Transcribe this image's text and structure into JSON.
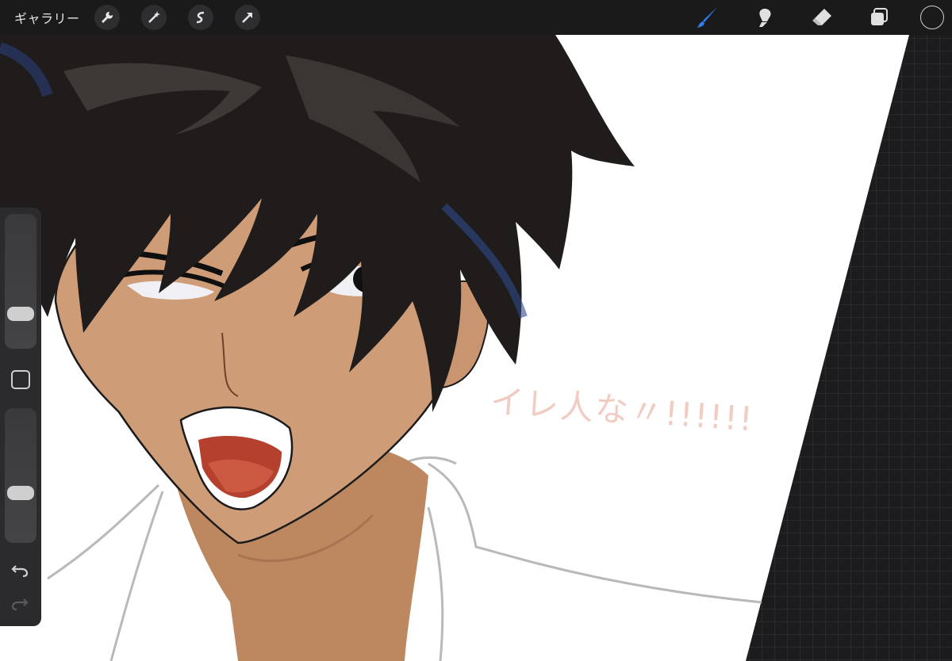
{
  "toolbar": {
    "gallery_label": "ギャラリー",
    "left_tools": [
      "wrench-icon",
      "magic-wand-icon",
      "selection-icon",
      "transform-arrow-icon"
    ],
    "right_tools": [
      "brush-icon",
      "smudge-icon",
      "eraser-icon",
      "layers-icon"
    ],
    "active_tool": "brush",
    "active_color": "#1a1a1a",
    "accent_color": "#2f80ed"
  },
  "sidebar": {
    "brush_size_level": 0.22,
    "opacity_level": 0.35,
    "modify_button_icon": "square-icon",
    "undo_icon": "undo-icon",
    "redo_icon": "redo-icon"
  },
  "artwork": {
    "sound_effect_text": "イレ人な〃!!!!!!"
  }
}
